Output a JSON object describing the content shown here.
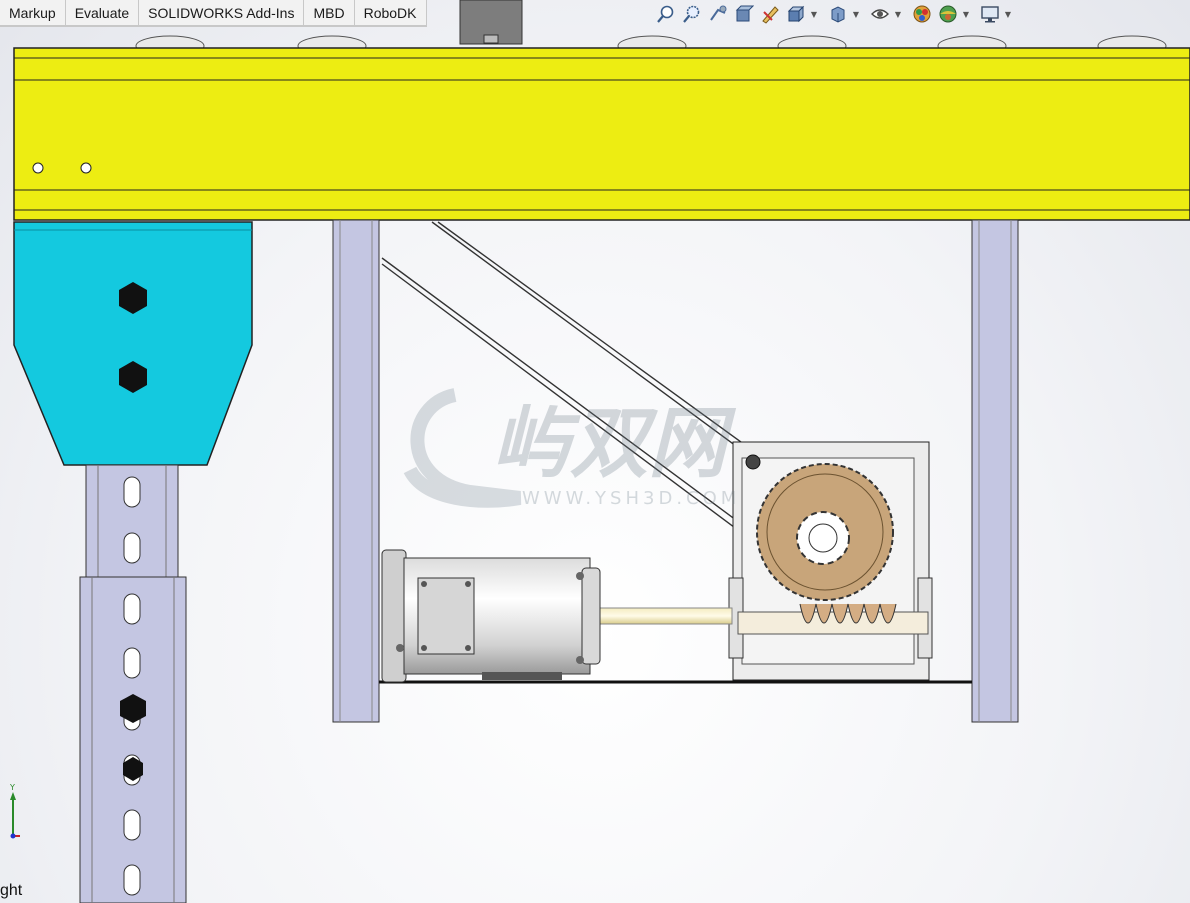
{
  "command_manager": {
    "tabs": [
      {
        "label": "Markup"
      },
      {
        "label": "Evaluate"
      },
      {
        "label": "SOLIDWORKS Add-Ins"
      },
      {
        "label": "MBD"
      },
      {
        "label": "RoboDK"
      }
    ]
  },
  "heads_up_toolbar": {
    "tools": [
      {
        "icon": "zoom-to-fit-icon"
      },
      {
        "icon": "zoom-to-area-icon"
      },
      {
        "icon": "previous-view-icon"
      },
      {
        "icon": "section-view-icon"
      },
      {
        "icon": "dynamic-annotation-icon"
      },
      {
        "icon": "view-orientation-icon"
      },
      {
        "icon": "display-style-icon"
      },
      {
        "icon": "hide-show-items-icon"
      },
      {
        "icon": "edit-appearance-icon"
      },
      {
        "icon": "apply-scene-icon"
      },
      {
        "icon": "view-settings-icon"
      }
    ]
  },
  "viewport": {
    "watermark": {
      "logo_text": "屿双网",
      "url_text": "WWW.YSH3D.COM"
    },
    "triad_axis_label": "Y",
    "view_orientation_label": "ght"
  },
  "colors": {
    "beam": "#eded12",
    "bracket": "#14c9df",
    "post": "#c4c6e2",
    "gear": "#c8a57a",
    "accent_bolt": "#111111"
  }
}
